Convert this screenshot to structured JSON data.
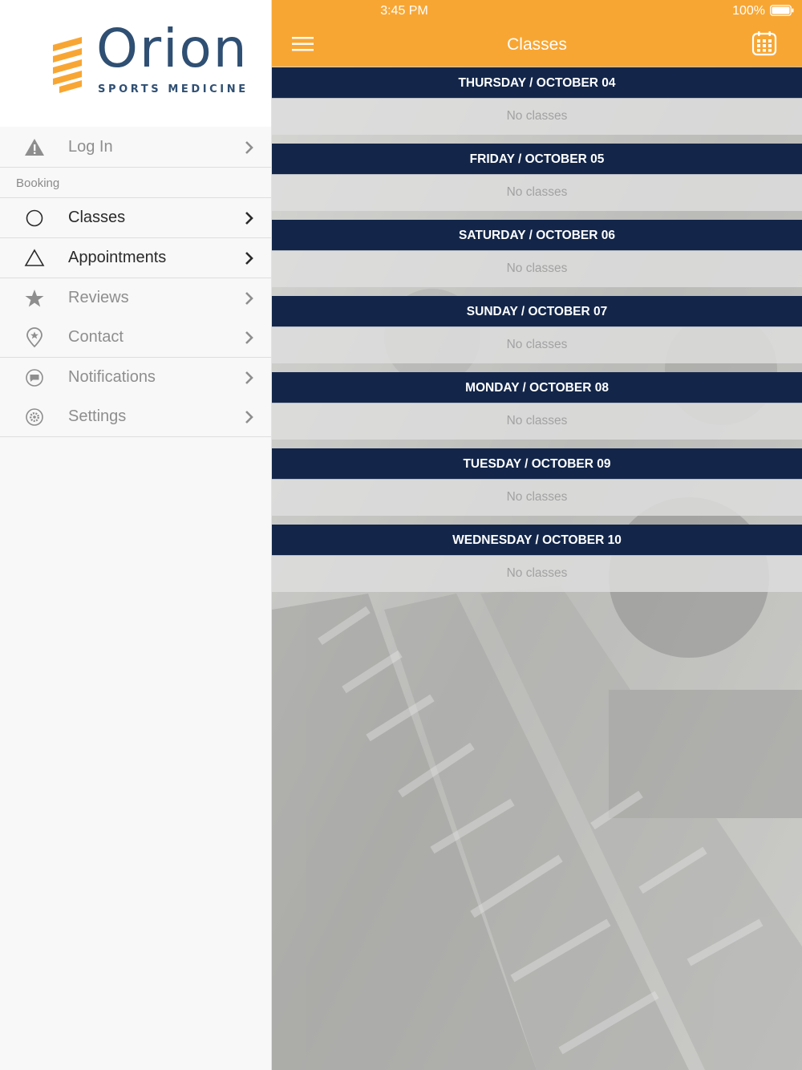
{
  "status_bar": {
    "time": "3:45 PM",
    "battery": "100%"
  },
  "logo": {
    "name": "Orion",
    "tagline": "SPORTS MEDICINE"
  },
  "sidebar": {
    "section_label": "Booking",
    "items": [
      {
        "label": "Log In",
        "icon": "warning-icon"
      },
      {
        "label": "Classes",
        "icon": "circle-icon"
      },
      {
        "label": "Appointments",
        "icon": "triangle-icon"
      },
      {
        "label": "Reviews",
        "icon": "star-icon"
      },
      {
        "label": "Contact",
        "icon": "location-pin-icon"
      },
      {
        "label": "Notifications",
        "icon": "chat-bubble-icon"
      },
      {
        "label": "Settings",
        "icon": "gear-icon"
      }
    ]
  },
  "header": {
    "title": "Classes",
    "menu_icon": "hamburger-icon",
    "calendar_icon": "calendar-icon"
  },
  "days": [
    {
      "heading": "THURSDAY / OCTOBER 04",
      "text": "No classes"
    },
    {
      "heading": "FRIDAY / OCTOBER 05",
      "text": "No classes"
    },
    {
      "heading": "SATURDAY / OCTOBER 06",
      "text": "No classes"
    },
    {
      "heading": "SUNDAY / OCTOBER 07",
      "text": "No classes"
    },
    {
      "heading": "MONDAY / OCTOBER 08",
      "text": "No classes"
    },
    {
      "heading": "TUESDAY / OCTOBER 09",
      "text": "No classes"
    },
    {
      "heading": "WEDNESDAY / OCTOBER 10",
      "text": "No classes"
    }
  ],
  "colors": {
    "accent": "#f8a633",
    "navy": "#13264a",
    "logo_blue": "#2f4f73"
  }
}
